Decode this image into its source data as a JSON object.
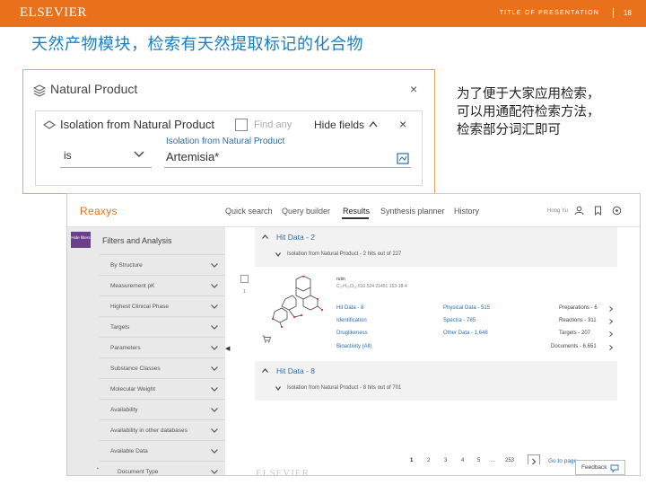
{
  "header": {
    "logo_text": "ELSEVIER",
    "presentation_title": "TITLE OF PRESENTATION",
    "page_number": "18",
    "bar_color": "#e9711c"
  },
  "slide": {
    "heading": "天然产物模块，检索有天然提取标记的化合物",
    "side_note": "为了便于大家应用检索，可以用通配符检索方法，检索部分词汇即可"
  },
  "natural_product_panel": {
    "title": "Natural Product",
    "close": "×",
    "row": {
      "title": "Isolation from Natural Product",
      "find_any": "Find any",
      "hide_fields": "Hide fields",
      "close": "×",
      "operator": "is",
      "field_label": "Isolation from Natural Product",
      "field_value": "Artemisia*"
    }
  },
  "reaxys": {
    "logo": "Reaxys",
    "nav": [
      "Quick search",
      "Query builder",
      "Results",
      "Synthesis planner",
      "History"
    ],
    "active_nav": "Results",
    "user": "Hong Yu",
    "sidebar": {
      "hide_badge": "Hide filters",
      "title": "Filters and Analysis",
      "items": [
        "By Structure",
        "Measurement pK",
        "Highest Clinical Phase",
        "Targets",
        "Parameters",
        "Substance Classes",
        "Molecular Weight",
        "Availability",
        "Availability in other databases",
        "Available Data",
        "Document Type"
      ]
    },
    "hits": [
      {
        "title": "Hit Data - 2",
        "subtitle": "Isolation from Natural Product - 2 hits out of 227"
      },
      {
        "title": "Hit Data - 8",
        "subtitle": "Isolation from Natural Product - 8 hits out of 701"
      }
    ],
    "compound": {
      "name": "rutin",
      "meta": "C₂₇H₃₀O₁₆   610.524   21451   153-18-4",
      "row_number": "1",
      "left_links": [
        "Hit Data - 8",
        "Identification",
        "Druglikeness",
        "Bioactivity (All)"
      ],
      "mid_links": [
        "Physical Data - 515",
        "Spectra - 785",
        "Other Data - 1,648"
      ],
      "right_links": [
        "Preparations - 6",
        "Reactions - 311",
        "Targets - 207",
        "Documents - 6,651"
      ]
    },
    "pager": {
      "pages": [
        "1",
        "2",
        "3",
        "4",
        "5",
        "...",
        "253"
      ],
      "go_to_page": "Go to page"
    },
    "feedback": "Feedback"
  }
}
